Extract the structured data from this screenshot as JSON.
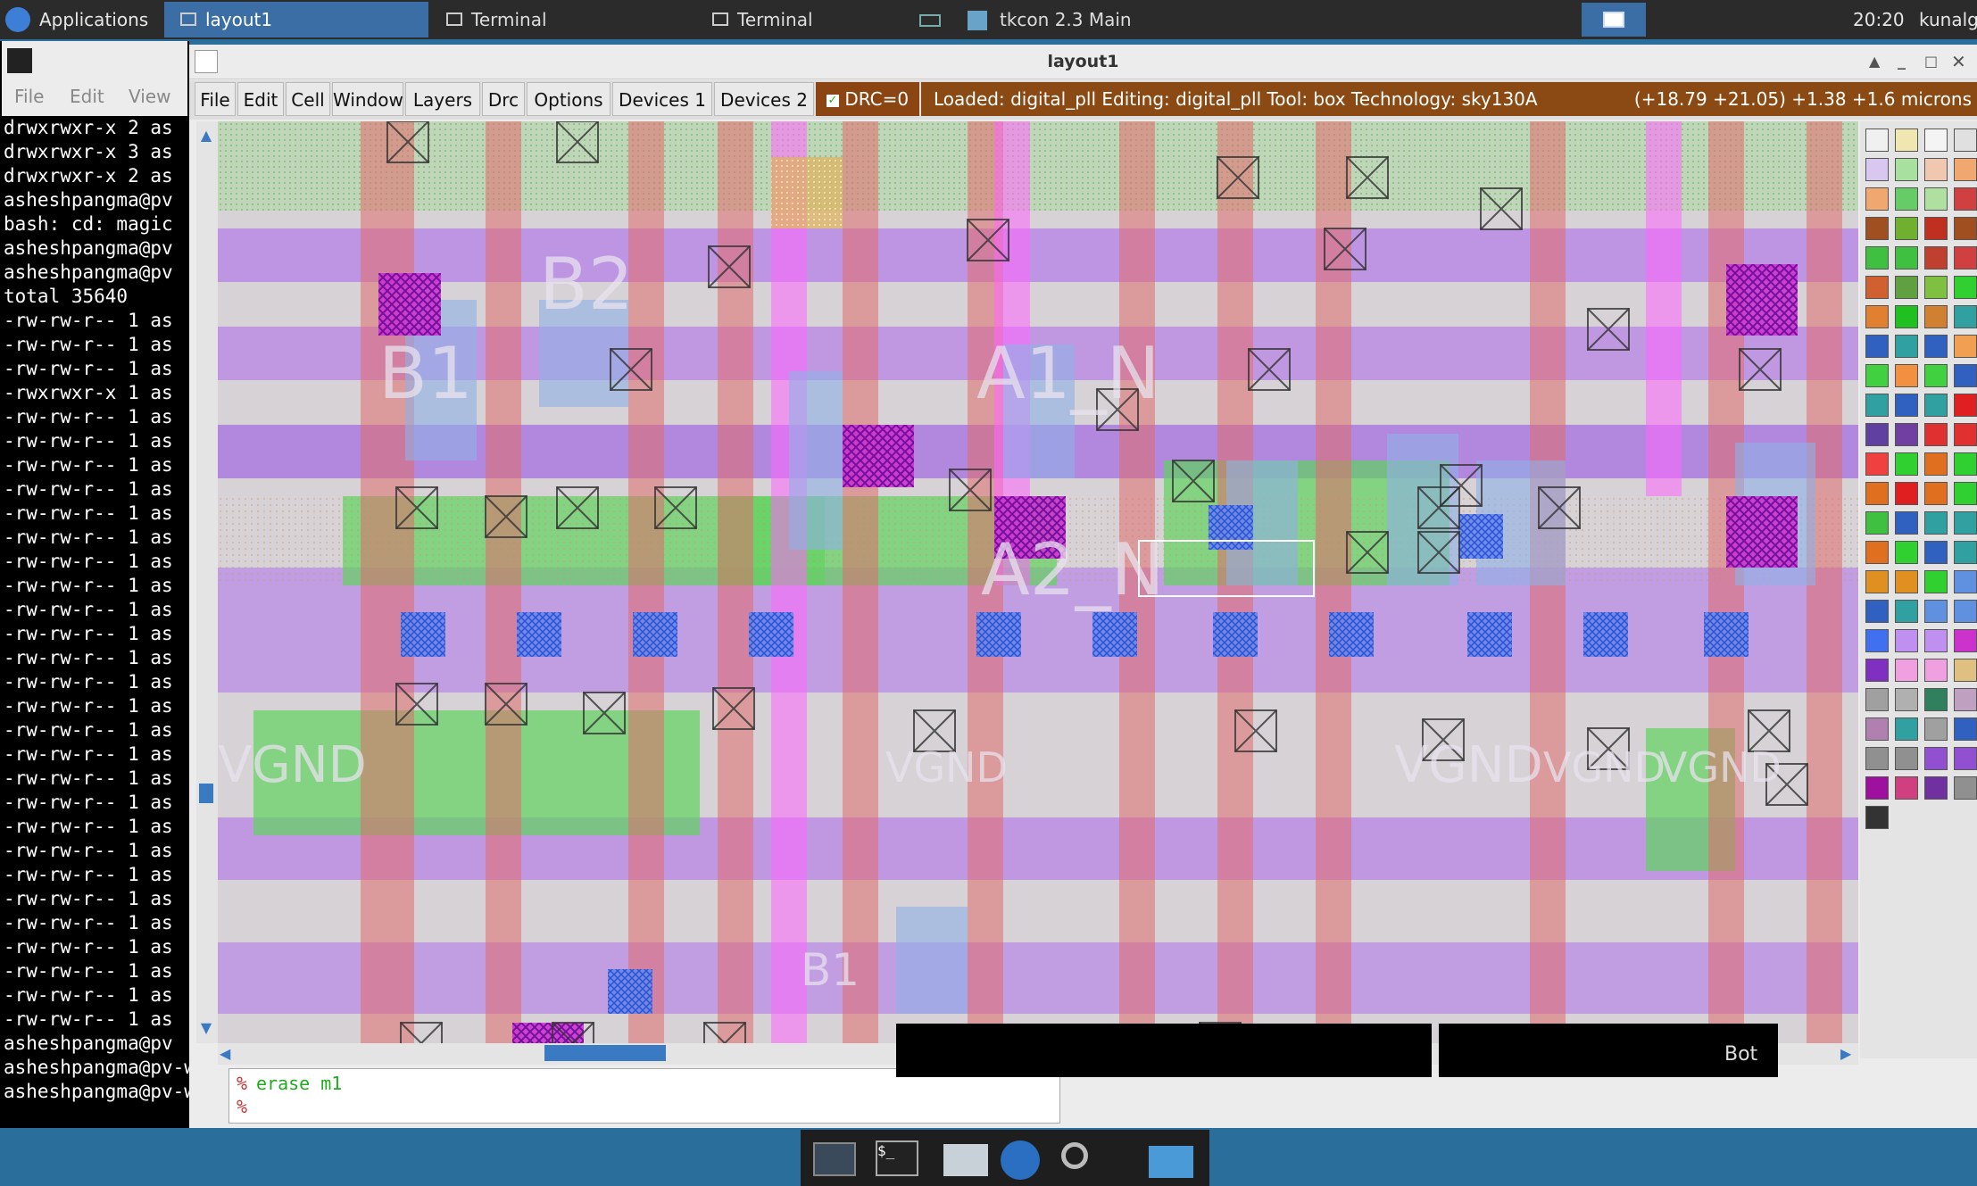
{
  "top_panel": {
    "applications_label": "Applications",
    "tasks": [
      {
        "label": "layout1",
        "active": true
      },
      {
        "label": "Terminal",
        "active": false
      },
      {
        "label": "Terminal",
        "active": false
      },
      {
        "label": "tkcon 2.3 Main",
        "active": false
      }
    ],
    "clock": "20:20",
    "user": "kunalg"
  },
  "terminal": {
    "menu": [
      "File",
      "Edit",
      "View"
    ],
    "lines": [
      "drwxrwxr-x 2 as",
      "drwxrwxr-x 3 as",
      "drwxrwxr-x 2 as",
      "asheshpangma@pv",
      "bash: cd: magic",
      "asheshpangma@pv",
      "asheshpangma@pv",
      "total 35640",
      "-rw-rw-r-- 1 as",
      "-rw-rw-r-- 1 as",
      "-rw-rw-r-- 1 as",
      "-rwxrwxr-x 1 as",
      "-rw-rw-r-- 1 as",
      "-rw-rw-r-- 1 as",
      "-rw-rw-r-- 1 as",
      "-rw-rw-r-- 1 as",
      "-rw-rw-r-- 1 as",
      "-rw-rw-r-- 1 as",
      "-rw-rw-r-- 1 as",
      "-rw-rw-r-- 1 as",
      "-rw-rw-r-- 1 as",
      "-rw-rw-r-- 1 as",
      "-rw-rw-r-- 1 as",
      "-rw-rw-r-- 1 as",
      "-rw-rw-r-- 1 as",
      "-rw-rw-r-- 1 as",
      "-rw-rw-r-- 1 as",
      "-rw-rw-r-- 1 as",
      "-rw-rw-r-- 1 as",
      "-rw-rw-r-- 1 as",
      "-rw-rw-r-- 1 as",
      "-rw-rw-r-- 1 as",
      "-rw-rw-r-- 1 as",
      "-rw-rw-r-- 1 as",
      "-rw-rw-r-- 1 as",
      "-rw-rw-r-- 1 as",
      "-rw-rw-r-- 1 as",
      "-rw-rw-r-- 1 as",
      "asheshpangma@pv",
      "asheshpangma@pv-wor",
      "asheshpangma@pv-wor"
    ]
  },
  "magic": {
    "window_title": "layout1",
    "menu": [
      "File",
      "Edit",
      "Cell",
      "Window",
      "Layers",
      "Drc",
      "Options",
      "Devices 1",
      "Devices 2"
    ],
    "drc_label": "DRC=0",
    "status": "Loaded: digital_pll  Editing: digital_pll  Tool: box  Technology: sky130A",
    "coords": "(+18.79 +21.05) +1.38 +1.6 microns",
    "labels": [
      "B2",
      "B1",
      "A1_N",
      "A2_N",
      "VGND",
      "VGND",
      "VGND",
      "VGND",
      "VGND",
      "B1"
    ],
    "command_lines": [
      "erase m1",
      ""
    ],
    "prompt": "%",
    "bot_label": "Bot"
  },
  "colors": {
    "panel": "#2b2b2b",
    "desktop": "#2a6f9b",
    "status_bar": "#8b4a13",
    "metal1": "#b37ae8",
    "poly": "#e06c6c",
    "diff": "#5fd35f",
    "licon": "#d24ad2",
    "background": "#d6d2d6"
  },
  "icons": [
    "applications-icon",
    "window-icon",
    "terminal-icon",
    "keyboard-icon",
    "tkcon-icon",
    "workspace-icon",
    "desktop-icon",
    "terminal-dock-icon",
    "home-folder-icon",
    "browser-icon",
    "search-icon",
    "folder-icon"
  ]
}
